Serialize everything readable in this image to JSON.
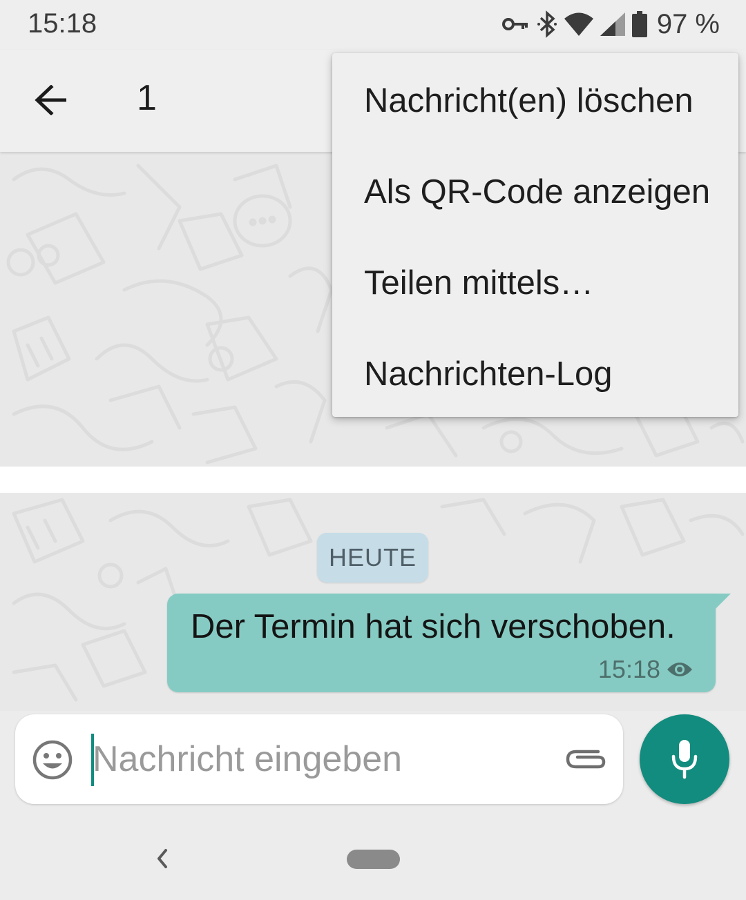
{
  "status_bar": {
    "time": "15:18",
    "battery_percent": "97 %",
    "icons": [
      "vpn-key-icon",
      "bluetooth-icon",
      "wifi-icon",
      "cell-signal-icon",
      "battery-icon"
    ]
  },
  "app_bar": {
    "selection_count": "1",
    "back_icon": "arrow-back-icon"
  },
  "overflow_menu": {
    "items": [
      {
        "label": "Nachricht(en) löschen"
      },
      {
        "label": "Als QR-Code anzeigen"
      },
      {
        "label": "Teilen mittels…"
      },
      {
        "label": "Nachrichten-Log"
      }
    ]
  },
  "chat": {
    "date_divider": "HEUTE",
    "messages": [
      {
        "text": "Der Termin hat sich verschoben.",
        "time": "15:18",
        "status_icon": "eye-icon"
      }
    ]
  },
  "composer": {
    "placeholder": "Nachricht eingeben",
    "value": ""
  },
  "colors": {
    "accent": "#128c7e",
    "bubble_outgoing": "#86cbc3",
    "date_chip": "#c6dde8"
  }
}
